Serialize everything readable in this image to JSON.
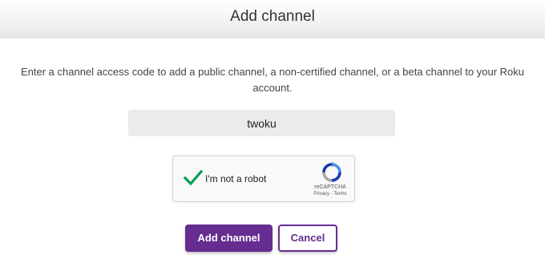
{
  "header": {
    "title": "Add channel"
  },
  "intro": {
    "line1": "Enter a channel access code to add a public channel, a non-certified channel, or a beta channel to your Roku",
    "line2": "account."
  },
  "code_field": {
    "value": "twoku"
  },
  "captcha": {
    "label": "I'm not a robot",
    "checked": true,
    "check_color": "#009e55",
    "brand": "reCAPTCHA",
    "links": "Privacy - Terms"
  },
  "actions": {
    "add_label": "Add channel",
    "cancel_label": "Cancel"
  },
  "colors": {
    "accent": "#662d91",
    "header_bg": "#f3f3f3",
    "input_bg": "#ebebeb"
  }
}
